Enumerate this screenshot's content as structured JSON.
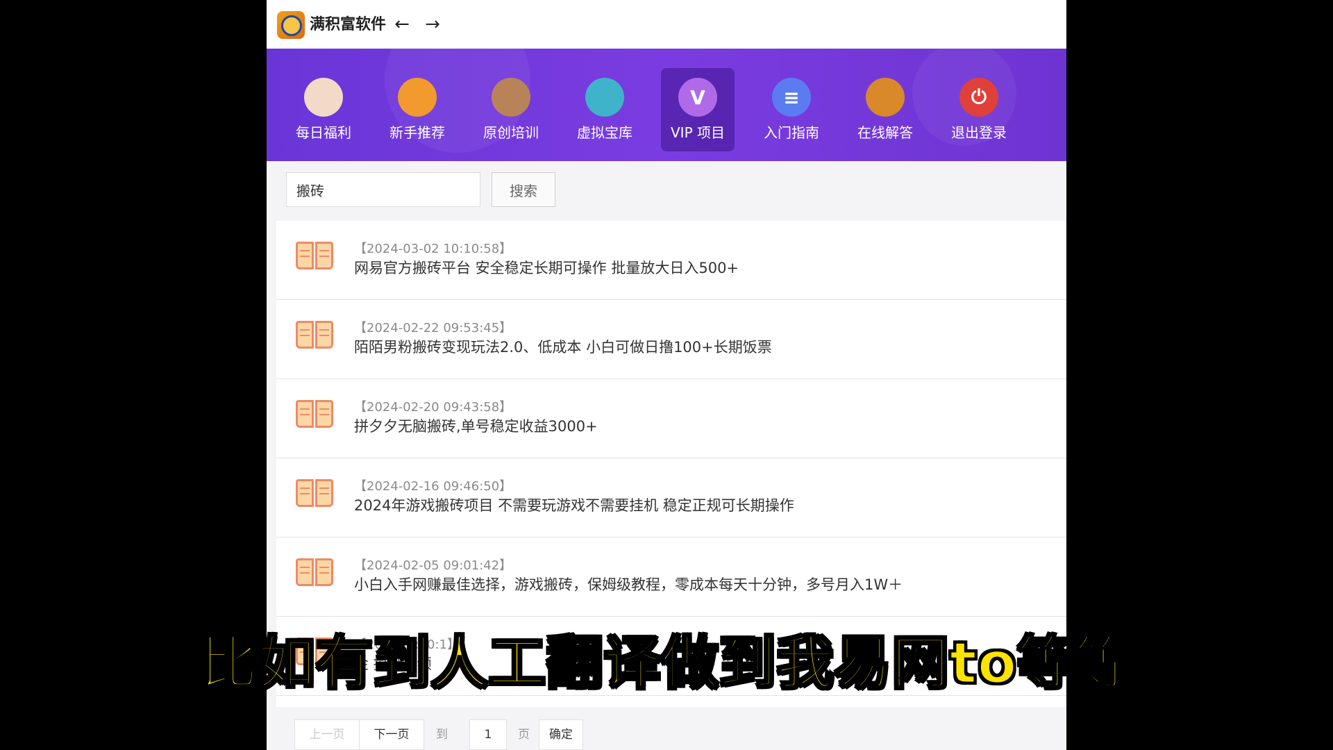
{
  "app": {
    "title": "满积富软件"
  },
  "nav": {
    "items": [
      {
        "label": "每日福利",
        "icon": "lucky-cat-icon",
        "color": "#f3d9c7",
        "active": false
      },
      {
        "label": "新手推荐",
        "icon": "thumbs-up-icon",
        "color": "#f29a2e",
        "active": false
      },
      {
        "label": "原创培训",
        "icon": "training-board-icon",
        "color": "#b9835a",
        "active": false
      },
      {
        "label": "虚拟宝库",
        "icon": "warehouse-icon",
        "color": "#3fb3c9",
        "active": false
      },
      {
        "label": "VIP 项目",
        "icon": "vip-icon",
        "color": "#b06ae8",
        "active": true
      },
      {
        "label": "入门指南",
        "icon": "document-icon",
        "color": "#5b7cf0",
        "active": false
      },
      {
        "label": "在线解答",
        "icon": "support-agent-icon",
        "color": "#d9882a",
        "active": false
      },
      {
        "label": "退出登录",
        "icon": "power-icon",
        "color": "#e0403a",
        "active": false
      }
    ]
  },
  "search": {
    "value": "搬砖",
    "button_label": "搜索"
  },
  "list": [
    {
      "date": "【2024-03-02 10:10:58】",
      "title": "网易官方搬砖平台 安全稳定长期可操作 批量放大日入500+"
    },
    {
      "date": "【2024-02-22 09:53:45】",
      "title": "陌陌男粉搬砖变现玩法2.0、低成本 小白可做日撸100+长期饭票"
    },
    {
      "date": "【2024-02-20 09:43:58】",
      "title": "拼夕夕无脑搬砖,单号稳定收益3000+"
    },
    {
      "date": "【2024-02-16 09:46:50】",
      "title": "2024年游戏搬砖项目 不需要玩游戏不需要挂机 稳定正规可长期操作"
    },
    {
      "date": "【2024-02-05 09:01:42】",
      "title": "小白入手网赚最佳选择，游戏搬砖，保姆级教程，零成本每天十分钟，多号月入1W＋"
    },
    {
      "date": "【2024-0  :00:1】",
      "title": "金  搞笑视频"
    }
  ],
  "pager": {
    "prev": "上一页",
    "next": "下一页",
    "goto": "到第",
    "page": "1",
    "unit": "页",
    "confirm": "确定"
  },
  "subtitle": "比如有到人工翻译做到我易网to等等"
}
